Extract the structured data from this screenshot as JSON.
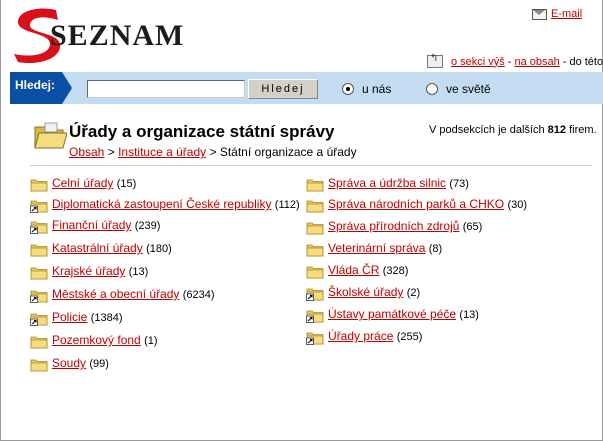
{
  "logo": {
    "text": "SEZNAM"
  },
  "header": {
    "email_label": "E-mail"
  },
  "section_nav": {
    "up": "o sekci výš",
    "sep": "-",
    "top": "na obsah",
    "more": "- do této"
  },
  "search": {
    "label": "Hledej:",
    "input_value": "",
    "button": "Hledej",
    "radio_cz": "u nás",
    "radio_world": "ve světě",
    "selected": "u nás"
  },
  "page": {
    "title": "Úřady a organizace státní správy",
    "count_prefix": "V podsekcích je dalších",
    "count": "812",
    "count_suffix": "firem."
  },
  "breadcrumb": {
    "root": "Obsah",
    "parent": "Instituce a úřady",
    "current": "Státní organizace a úřady",
    "sep": ">"
  },
  "left_items": [
    {
      "label": "Celní úřady",
      "count": "(15)",
      "icon": "folder-icon"
    },
    {
      "label": "Diplomatická zastoupení České republiky",
      "count": "(112)",
      "icon": "folder-link-icon"
    },
    {
      "label": "Finanční úřady",
      "count": "(239)",
      "icon": "folder-link-icon"
    },
    {
      "label": "Katastrální úřady",
      "count": "(180)",
      "icon": "folder-icon"
    },
    {
      "label": "Krajské úřady",
      "count": "(13)",
      "icon": "folder-icon"
    },
    {
      "label": "Městské a obecní úřady",
      "count": "(6234)",
      "icon": "folder-link-icon"
    },
    {
      "label": "Policie",
      "count": "(1384)",
      "icon": "folder-link-icon"
    },
    {
      "label": "Pozemkový fond",
      "count": "(1)",
      "icon": "folder-icon"
    },
    {
      "label": "Soudy",
      "count": "(99)",
      "icon": "folder-icon"
    }
  ],
  "right_items": [
    {
      "label": "Správa a údržba silnic",
      "count": "(73)",
      "icon": "folder-icon"
    },
    {
      "label": "Správa národních parků a CHKO",
      "count": "(30)",
      "icon": "folder-icon"
    },
    {
      "label": "Správa přírodních zdrojů",
      "count": "(65)",
      "icon": "folder-icon"
    },
    {
      "label": "Veterinární správa",
      "count": "(8)",
      "icon": "folder-icon"
    },
    {
      "label": "Vláda ČR",
      "count": "(328)",
      "icon": "folder-icon"
    },
    {
      "label": "Školské úřady",
      "count": "(2)",
      "icon": "folder-link-icon"
    },
    {
      "label": "Ústavy památkové péče",
      "count": "(13)",
      "icon": "folder-link-icon"
    },
    {
      "label": "Úřady práce",
      "count": "(255)",
      "icon": "folder-link-icon"
    }
  ],
  "colors": {
    "link": "#c00000",
    "search_bg": "#c4dcf2",
    "search_label_bg": "#0a4fa3",
    "folder": "#f2d36b"
  }
}
